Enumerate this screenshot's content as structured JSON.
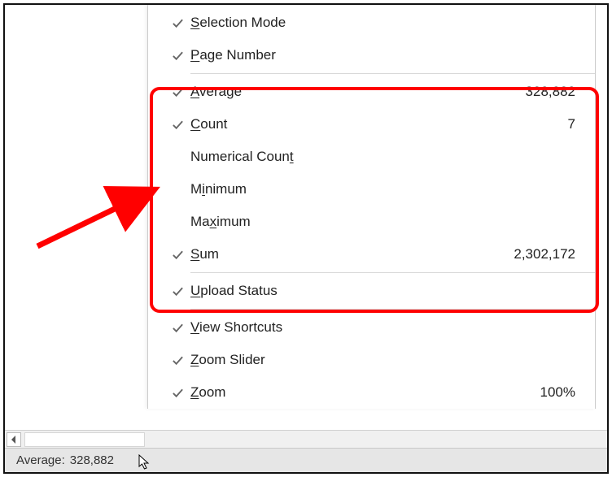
{
  "menu": {
    "items": [
      {
        "checked": true,
        "label": "Selection Mode",
        "underline": "S",
        "value": ""
      },
      {
        "checked": true,
        "label": "Page Number",
        "underline": "P",
        "value": ""
      },
      {
        "checked": true,
        "label": "Average",
        "underline": "A",
        "value": "328,882"
      },
      {
        "checked": true,
        "label": "Count",
        "underline": "C",
        "value": "7"
      },
      {
        "checked": false,
        "label": "Numerical Count",
        "underline": "t",
        "value": ""
      },
      {
        "checked": false,
        "label": "Minimum",
        "underline": "i",
        "value": ""
      },
      {
        "checked": false,
        "label": "Maximum",
        "underline": "x",
        "value": ""
      },
      {
        "checked": true,
        "label": "Sum",
        "underline": "S",
        "value": "2,302,172"
      },
      {
        "checked": true,
        "label": "Upload Status",
        "underline": "U",
        "value": ""
      },
      {
        "checked": true,
        "label": "View Shortcuts",
        "underline": "V",
        "value": ""
      },
      {
        "checked": true,
        "label": "Zoom Slider",
        "underline": "Z",
        "value": ""
      },
      {
        "checked": true,
        "label": "Zoom",
        "underline": "Z",
        "value": "100%"
      }
    ],
    "separators_after": [
      1,
      7,
      8
    ]
  },
  "status": {
    "label": "Average:",
    "value": "328,882"
  }
}
